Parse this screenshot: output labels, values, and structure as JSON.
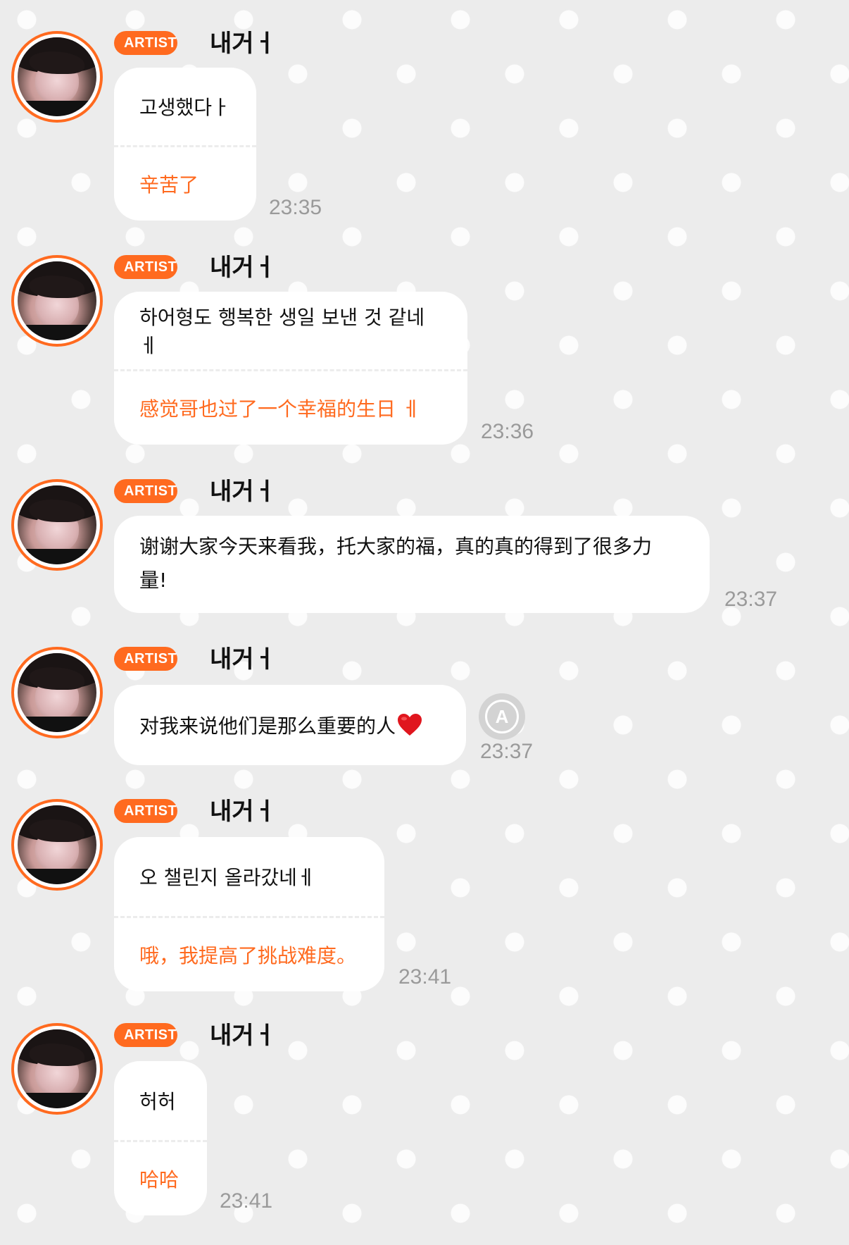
{
  "colors": {
    "accent": "#ff6a1f",
    "background": "#ececec",
    "bubble": "#ffffff",
    "timestamp": "#9a9a9a"
  },
  "messages": [
    {
      "badge": "ARTIST",
      "name": "내거ㅓ",
      "original": "고생했다ㅏ",
      "translation": "辛苦了",
      "time": "23:35"
    },
    {
      "badge": "ARTIST",
      "name": "내거ㅓ",
      "original": "하어형도 행복한 생일 보낸 것 같네ㅔ",
      "translation": "感觉哥也过了一个幸福的生日 ㅔ",
      "time": "23:36"
    },
    {
      "badge": "ARTIST",
      "name": "내거ㅓ",
      "original_line1": "谢谢大家今天来看我，托大家的福，真的真的得到了很多力",
      "original_line2": "量!",
      "time": "23:37"
    },
    {
      "badge": "ARTIST",
      "name": "내거ㅓ",
      "original": "对我来说他们是那么重要的人",
      "emoji": "red-heart",
      "translate_icon": "A",
      "time": "23:37"
    },
    {
      "badge": "ARTIST",
      "name": "내거ㅓ",
      "original": "오 챌린지 올라갔네ㅔ",
      "translation": "哦，我提高了挑战难度。",
      "time": "23:41"
    },
    {
      "badge": "ARTIST",
      "name": "내거ㅓ",
      "original": "허허",
      "translation": "哈哈",
      "time": "23:41"
    }
  ]
}
